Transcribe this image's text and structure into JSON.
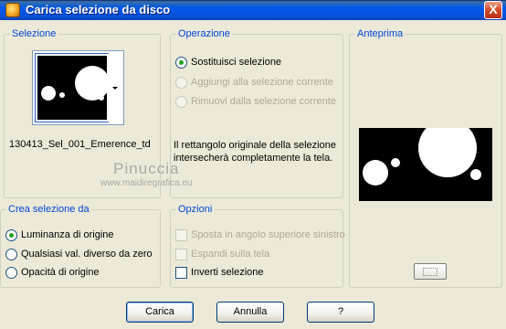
{
  "window": {
    "title": "Carica selezione da disco",
    "close_label": "X"
  },
  "selezione": {
    "legend": "Selezione",
    "filename": "130413_Sel_001_Emerence_td"
  },
  "operazione": {
    "legend": "Operazione",
    "options": [
      {
        "label": "Sostituisci selezione",
        "checked": true,
        "enabled": true
      },
      {
        "label": "Aggiungi alla selezione corrente",
        "checked": false,
        "enabled": false
      },
      {
        "label": "Rimuovi dalla selezione corrente",
        "checked": false,
        "enabled": false
      }
    ],
    "info": "Il rettangolo originale della selezione intersecherà completamente la tela."
  },
  "anteprima": {
    "legend": "Anteprima"
  },
  "watermark": {
    "line1": "Pinuccia",
    "line2": "www.maidiregrafica.eu"
  },
  "crea": {
    "legend": "Crea selezione da",
    "options": [
      {
        "label": "Luminanza di origine",
        "checked": true
      },
      {
        "label": "Qualsiasi val. diverso da zero",
        "checked": false
      },
      {
        "label": "Opacità di origine",
        "checked": false
      }
    ]
  },
  "opzioni": {
    "legend": "Opzioni",
    "options": [
      {
        "label": "Sposta in angolo superiore sinistro",
        "checked": false,
        "enabled": false
      },
      {
        "label": "Espandi sulla tela",
        "checked": false,
        "enabled": false
      },
      {
        "label": "Inverti selezione",
        "checked": false,
        "enabled": true
      }
    ]
  },
  "buttons": {
    "ok": "Carica",
    "cancel": "Annulla",
    "help": "?"
  }
}
